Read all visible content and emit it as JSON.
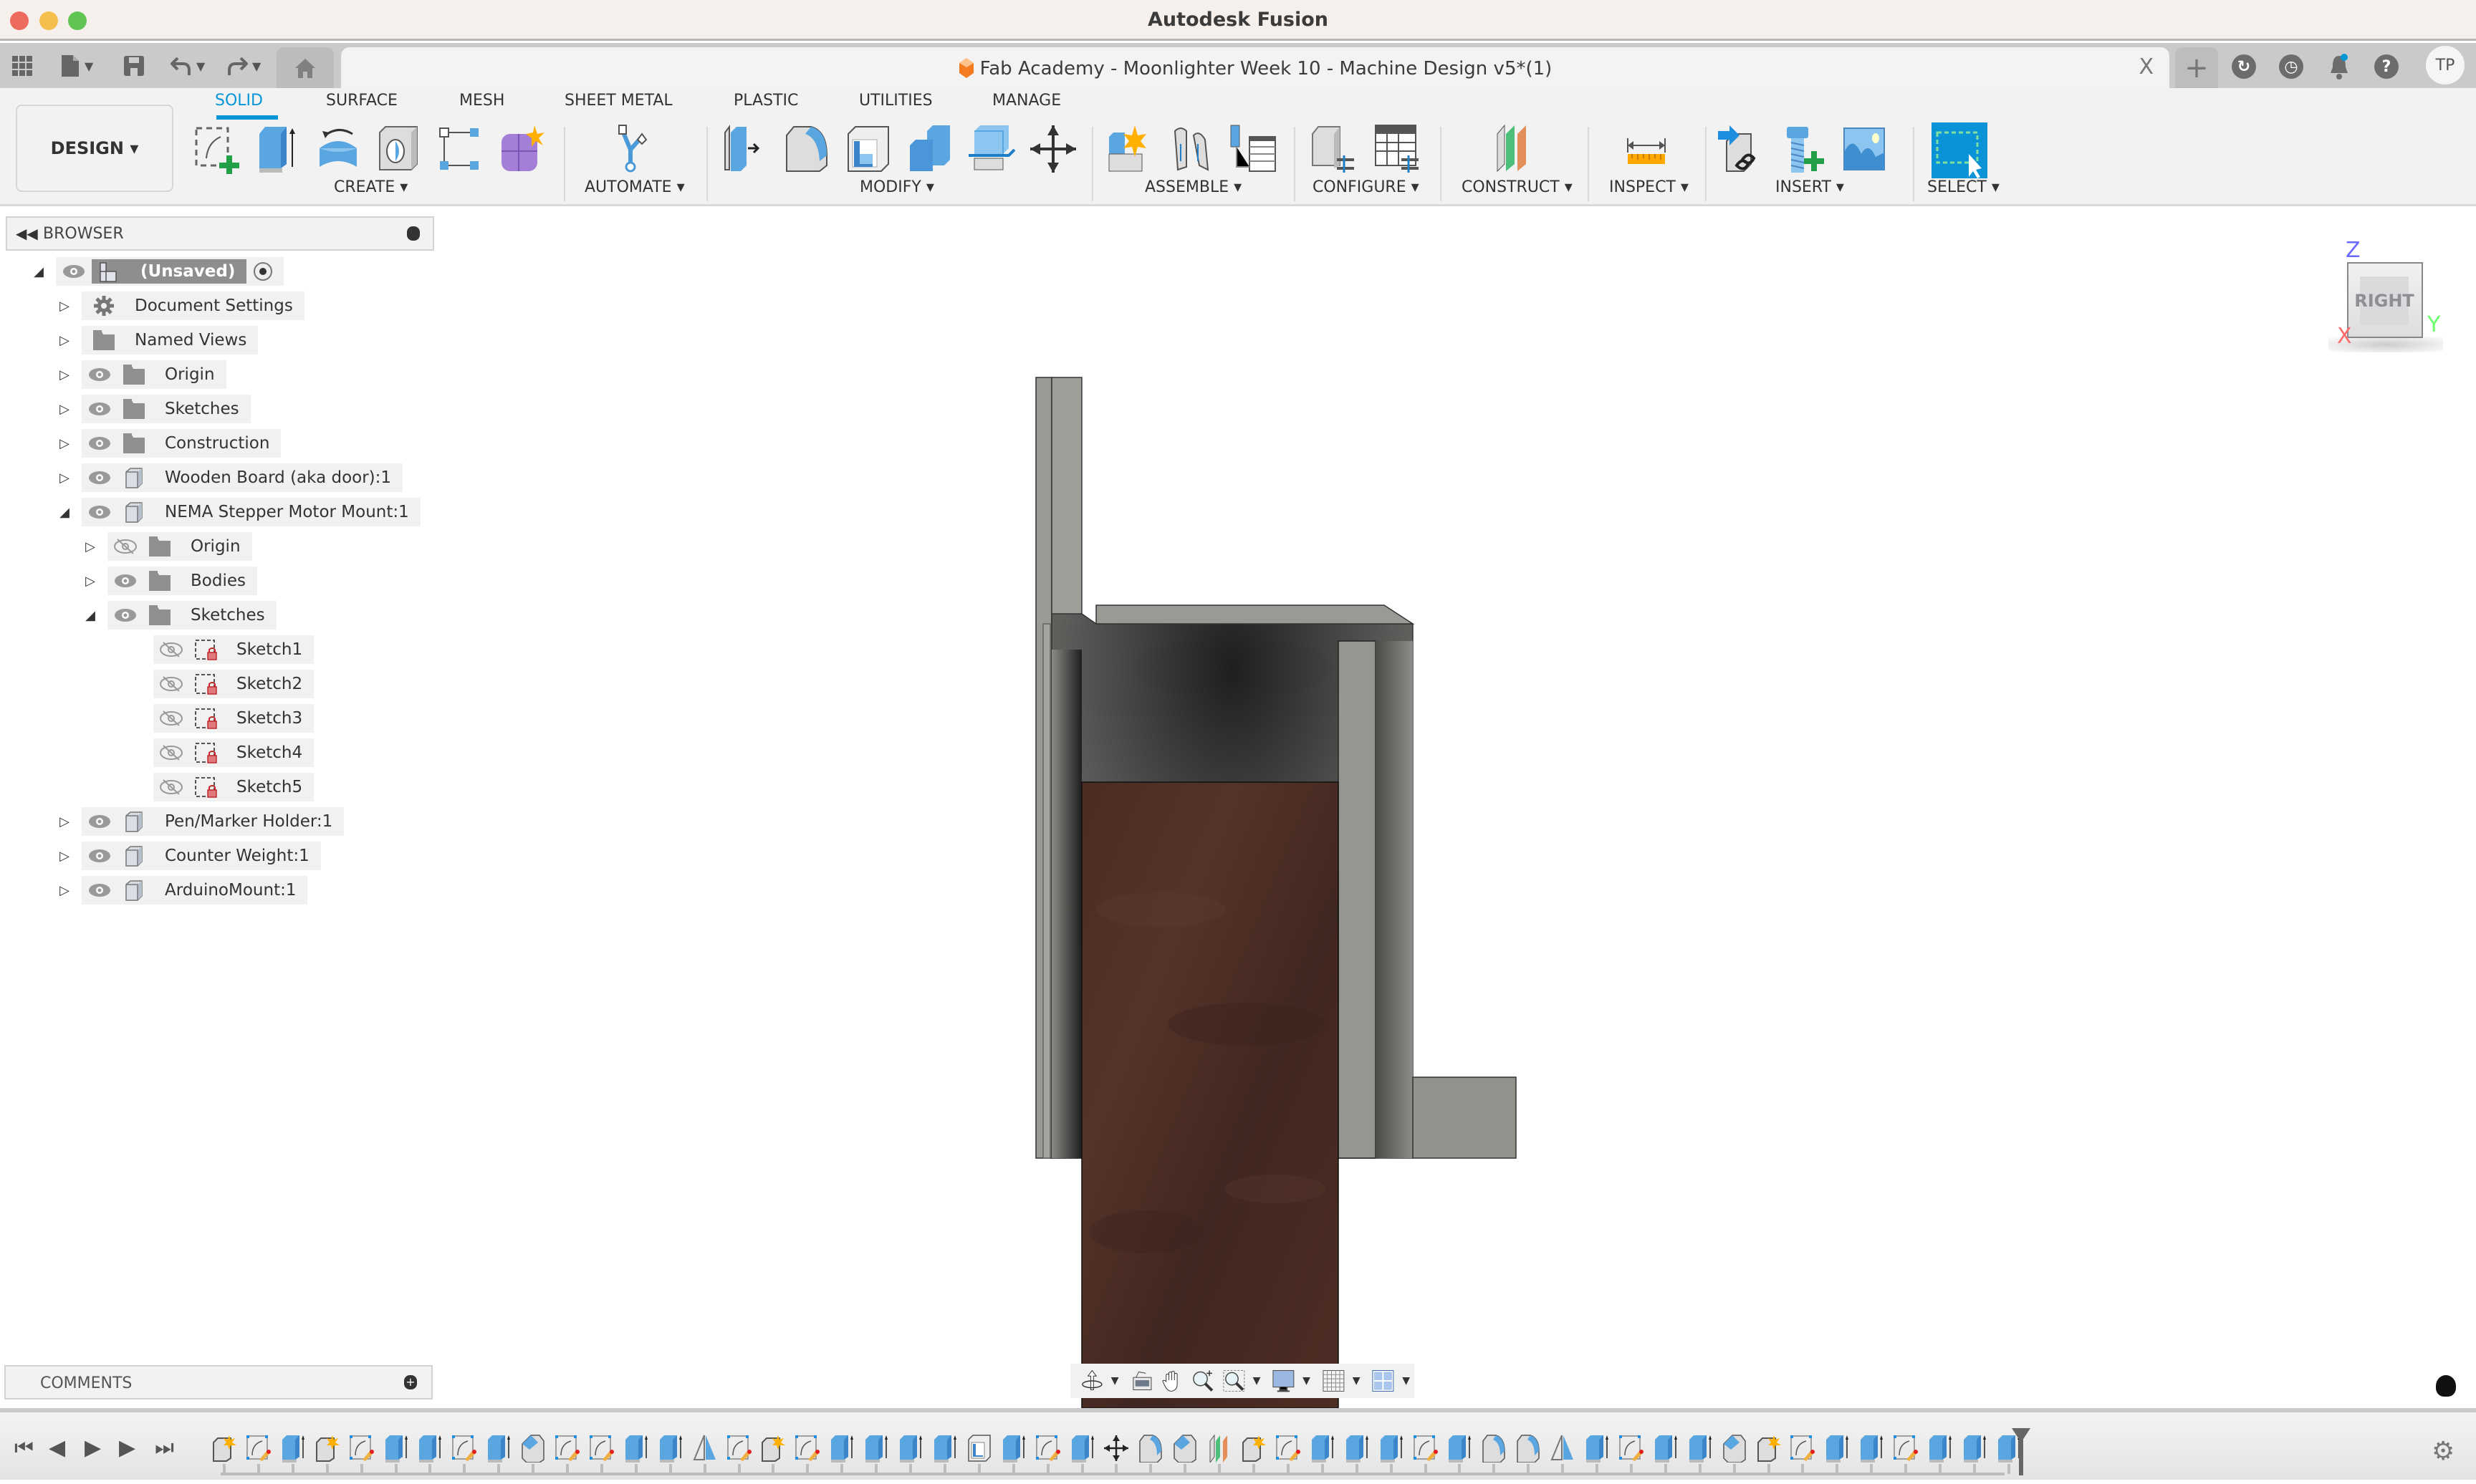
{
  "window": {
    "app_title": "Autodesk Fusion",
    "traffic_lights": [
      "close",
      "minimize",
      "zoom"
    ]
  },
  "quick_access": {
    "items": [
      "apps-grid-icon",
      "file-icon",
      "save-icon",
      "undo-icon",
      "redo-icon"
    ],
    "home_tab": "home-icon"
  },
  "document": {
    "title": "Fab Academy - Moonlighter Week 10 - Machine Design v5*(1)",
    "close_label": "X"
  },
  "top_right": {
    "new_tab_label": "+",
    "icons": [
      "extensions-icon",
      "job-status-icon",
      "notifications-icon",
      "help-icon"
    ],
    "avatar_initials": "TP",
    "notification_accent": "#0696d7"
  },
  "toolbar": {
    "workspace_button": "DESIGN ▾",
    "workspace_tabs": [
      {
        "label": "SOLID",
        "active": true
      },
      {
        "label": "SURFACE",
        "active": false
      },
      {
        "label": "MESH",
        "active": false
      },
      {
        "label": "SHEET METAL",
        "active": false
      },
      {
        "label": "PLASTIC",
        "active": false
      },
      {
        "label": "UTILITIES",
        "active": false
      },
      {
        "label": "MANAGE",
        "active": false
      }
    ],
    "groups": [
      {
        "label": "CREATE ▾",
        "tools": [
          "create-sketch",
          "extrude",
          "revolve",
          "hole",
          "rectangular-pattern",
          "create-form"
        ]
      },
      {
        "label": "AUTOMATE ▾",
        "tools": [
          "automate"
        ]
      },
      {
        "label": "MODIFY ▾",
        "tools": [
          "press-pull",
          "fillet",
          "shell",
          "combine",
          "offset-face",
          "move-copy"
        ]
      },
      {
        "label": "ASSEMBLE ▾",
        "tools": [
          "new-component",
          "joint",
          "bill-of-materials"
        ]
      },
      {
        "label": "CONFIGURE ▾",
        "tools": [
          "configure-model",
          "configuration-table"
        ]
      },
      {
        "label": "CONSTRUCT ▾",
        "tools": [
          "offset-plane"
        ]
      },
      {
        "label": "INSPECT ▾",
        "tools": [
          "measure"
        ]
      },
      {
        "label": "INSERT ▾",
        "tools": [
          "insert-derive",
          "insert-mcmaster",
          "insert-canvas"
        ]
      },
      {
        "label": "SELECT ▾",
        "tools": [
          "select"
        ]
      }
    ],
    "accent": "#0696d7"
  },
  "browser": {
    "title": "BROWSER",
    "tree": [
      {
        "label": "(Unsaved)",
        "level": 0,
        "expand": "expanded",
        "eye": "visible",
        "icon": "root-component",
        "selected": true,
        "radio": true
      },
      {
        "label": "Document Settings",
        "level": 1,
        "expand": "collapsed",
        "eye": "none",
        "icon": "gear"
      },
      {
        "label": "Named Views",
        "level": 1,
        "expand": "collapsed",
        "eye": "none",
        "icon": "folder"
      },
      {
        "label": "Origin",
        "level": 1,
        "expand": "collapsed",
        "eye": "visible",
        "icon": "folder"
      },
      {
        "label": "Sketches",
        "level": 1,
        "expand": "collapsed",
        "eye": "visible",
        "icon": "folder"
      },
      {
        "label": "Construction",
        "level": 1,
        "expand": "collapsed",
        "eye": "visible",
        "icon": "folder"
      },
      {
        "label": "Wooden Board (aka door):1",
        "level": 1,
        "expand": "collapsed",
        "eye": "visible",
        "icon": "component"
      },
      {
        "label": "NEMA Stepper Motor Mount:1",
        "level": 1,
        "expand": "expanded",
        "eye": "visible",
        "icon": "component"
      },
      {
        "label": "Origin",
        "level": 2,
        "expand": "collapsed",
        "eye": "hidden",
        "icon": "folder"
      },
      {
        "label": "Bodies",
        "level": 2,
        "expand": "collapsed",
        "eye": "visible",
        "icon": "folder"
      },
      {
        "label": "Sketches",
        "level": 2,
        "expand": "expanded",
        "eye": "visible",
        "icon": "folder"
      },
      {
        "label": "Sketch1",
        "level": 3,
        "expand": "none",
        "eye": "hidden",
        "icon": "sketch-locked"
      },
      {
        "label": "Sketch2",
        "level": 3,
        "expand": "none",
        "eye": "hidden",
        "icon": "sketch-locked"
      },
      {
        "label": "Sketch3",
        "level": 3,
        "expand": "none",
        "eye": "hidden",
        "icon": "sketch-locked"
      },
      {
        "label": "Sketch4",
        "level": 3,
        "expand": "none",
        "eye": "hidden",
        "icon": "sketch-locked"
      },
      {
        "label": "Sketch5",
        "level": 3,
        "expand": "none",
        "eye": "hidden",
        "icon": "sketch-locked"
      },
      {
        "label": "Pen/Marker Holder:1",
        "level": 1,
        "expand": "collapsed",
        "eye": "visible",
        "icon": "component"
      },
      {
        "label": "Counter Weight:1",
        "level": 1,
        "expand": "collapsed",
        "eye": "visible",
        "icon": "component"
      },
      {
        "label": "ArduinoMount:1",
        "level": 1,
        "expand": "collapsed",
        "eye": "visible",
        "icon": "component"
      }
    ]
  },
  "viewcube": {
    "face": "RIGHT",
    "axes": {
      "z": "Z",
      "x": "X",
      "y": "Y"
    },
    "axis_colors": {
      "z": "#6b6bff",
      "x": "#ff6b6b",
      "y": "#6bff6b"
    }
  },
  "navbar": {
    "tools": [
      "orbit",
      "look-at",
      "pan",
      "zoom",
      "fit",
      "display-settings",
      "grid-snaps",
      "viewports"
    ]
  },
  "comments": {
    "title": "COMMENTS"
  },
  "timeline": {
    "controls": [
      "go-to-start",
      "step-back",
      "play",
      "step-forward",
      "go-to-end"
    ],
    "features": [
      "component",
      "sketch",
      "extrude",
      "component",
      "sketch",
      "extrude",
      "extrude",
      "sketch",
      "extrude",
      "chamfer",
      "sketch",
      "sketch",
      "extrude",
      "extrude",
      "mirror",
      "sketch",
      "component",
      "sketch",
      "extrude",
      "extrude",
      "extrude",
      "extrude",
      "shell",
      "extrude",
      "sketch",
      "extrude",
      "move",
      "fillet",
      "chamfer",
      "plane",
      "component",
      "sketch",
      "extrude",
      "extrude",
      "extrude",
      "sketch",
      "extrude",
      "fillet",
      "fillet",
      "mirror",
      "extrude",
      "sketch",
      "extrude",
      "extrude",
      "chamfer",
      "component",
      "sketch",
      "extrude",
      "extrude",
      "sketch",
      "extrude",
      "extrude",
      "extrude"
    ]
  },
  "model": {
    "wood_color": "#4a2c24",
    "metal_color": "#9a9a95"
  }
}
